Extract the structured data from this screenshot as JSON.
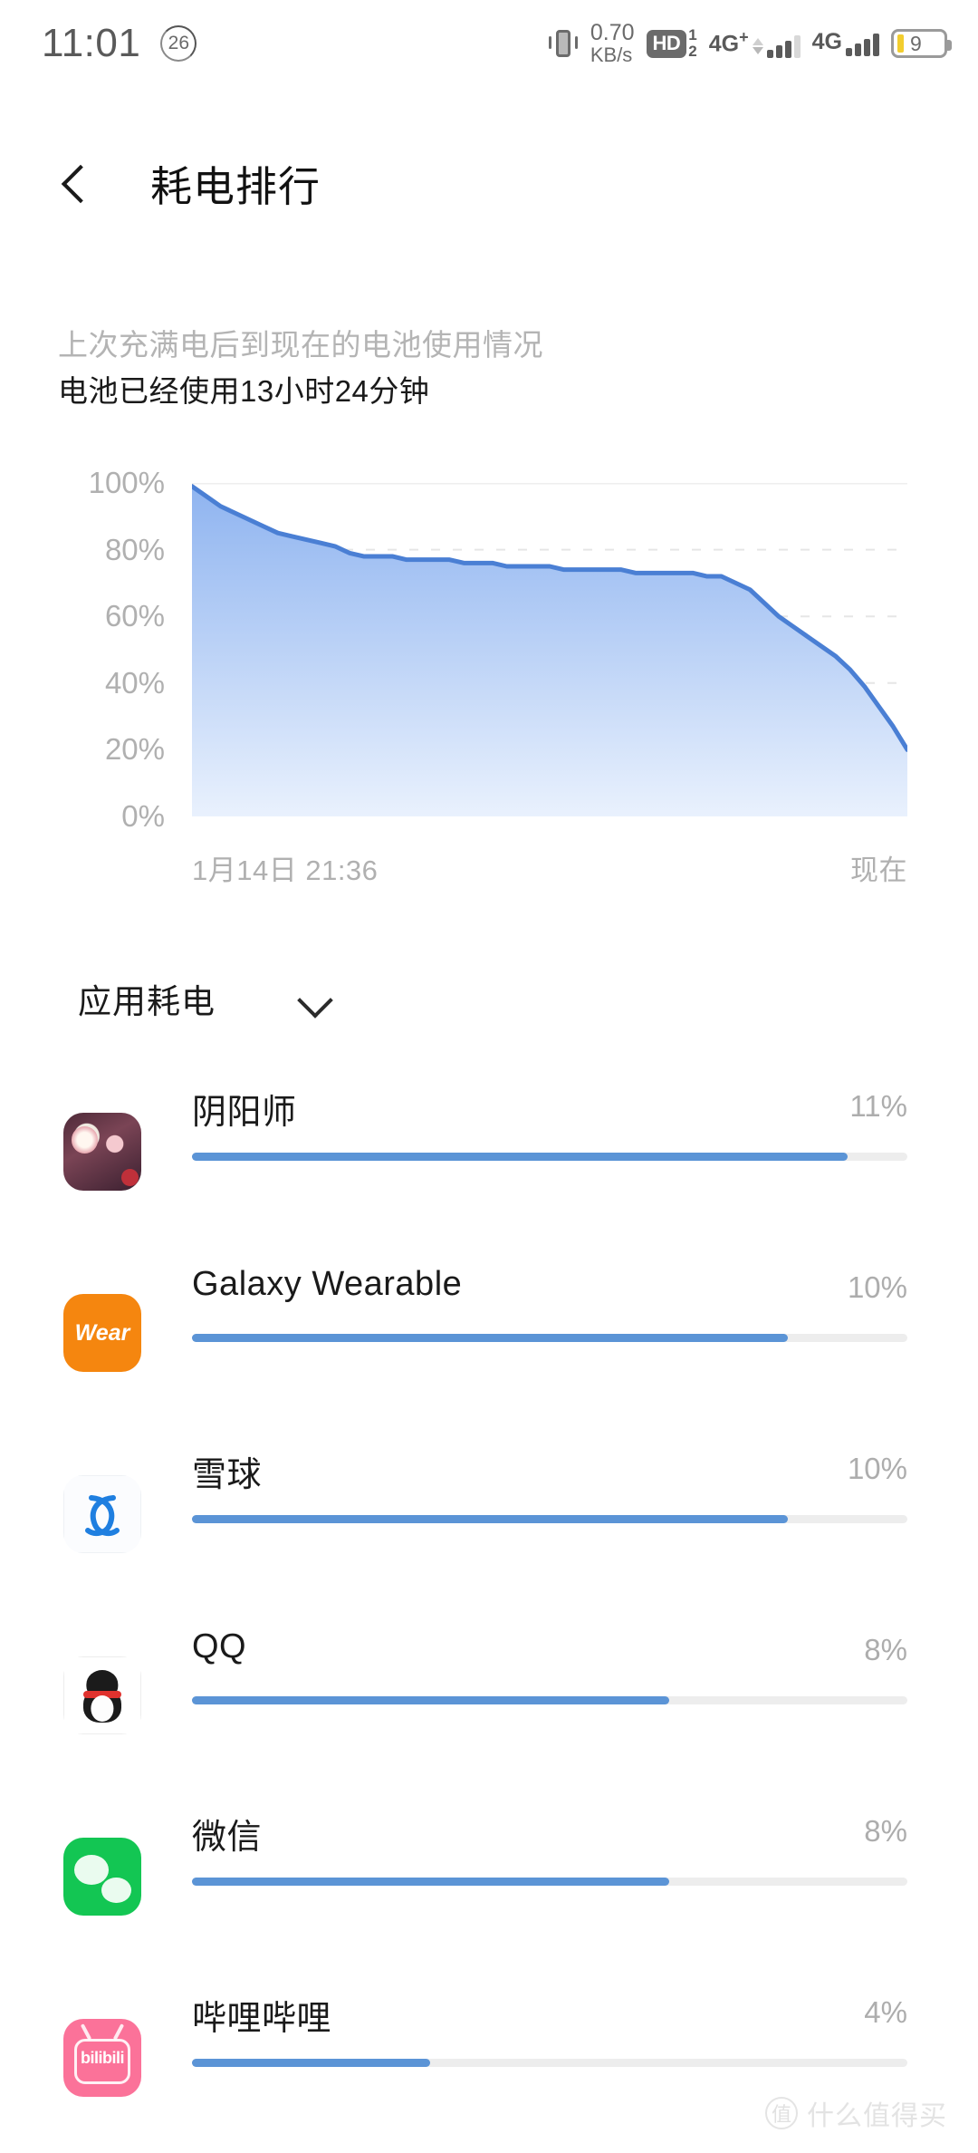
{
  "status_bar": {
    "time": "11:01",
    "badge_count": "26",
    "network_rate": "0.70",
    "network_unit": "KB/s",
    "hd_label": "HD",
    "sim1": "1",
    "sim2": "2",
    "signal_a": "4G",
    "signal_a_plus": "+",
    "signal_b": "4G",
    "battery_level": "9",
    "icons": {
      "vibrate": "vibrate-icon",
      "hd_call": "hd-call-icon",
      "signal": "signal-bars-icon",
      "battery": "battery-icon"
    }
  },
  "app_bar": {
    "back_icon": "back-chevron-icon",
    "title": "耗电排行"
  },
  "summary": {
    "line_gray": "上次充满电后到现在的电池使用情况",
    "line_dark": "电池已经使用13小时24分钟"
  },
  "chart_data": {
    "type": "area",
    "title": "",
    "subtitle": "",
    "xlabel": "",
    "ylabel": "",
    "ylim": [
      0,
      100
    ],
    "grid": true,
    "legend": null,
    "y_ticks": [
      "0%",
      "20%",
      "40%",
      "60%",
      "80%",
      "100%"
    ],
    "y_tick_values": [
      0,
      20,
      40,
      60,
      80,
      100
    ],
    "x_ticks": [
      "1月14日 21:36",
      "现在"
    ],
    "line_color": "#4a7fd4",
    "fill_color_top": "#8fb4f0",
    "fill_color_bottom": "#e8f0fd",
    "x": [
      0,
      2,
      4,
      6,
      8,
      10,
      12,
      14,
      16,
      18,
      20,
      22,
      24,
      26,
      28,
      30,
      32,
      34,
      36,
      38,
      40,
      42,
      44,
      46,
      48,
      50,
      52,
      54,
      56,
      58,
      60,
      62,
      64,
      66,
      68,
      70,
      72,
      74,
      76,
      78,
      80,
      82,
      84,
      86,
      88,
      90,
      92,
      94,
      96,
      98,
      100
    ],
    "values": [
      99,
      96,
      93,
      91,
      89,
      87,
      85,
      84,
      83,
      82,
      81,
      79,
      78,
      78,
      78,
      77,
      77,
      77,
      77,
      76,
      76,
      76,
      75,
      75,
      75,
      75,
      74,
      74,
      74,
      74,
      74,
      73,
      73,
      73,
      73,
      73,
      72,
      72,
      70,
      68,
      64,
      60,
      57,
      54,
      51,
      48,
      44,
      39,
      33,
      27,
      20,
      9
    ]
  },
  "section": {
    "label": "应用耗电",
    "chevron_icon": "chevron-down-icon"
  },
  "apps": [
    {
      "name": "阴阳师",
      "percent": "11%",
      "value": 11,
      "icon": "onmyoji-app-icon"
    },
    {
      "name": "Galaxy Wearable",
      "percent": "10%",
      "value": 10,
      "icon": "galaxy-wearable-app-icon",
      "icon_text": "Wear"
    },
    {
      "name": "雪球",
      "percent": "10%",
      "value": 10,
      "icon": "xueqiu-app-icon"
    },
    {
      "name": "QQ",
      "percent": "8%",
      "value": 8,
      "icon": "qq-app-icon"
    },
    {
      "name": "微信",
      "percent": "8%",
      "value": 8,
      "icon": "wechat-app-icon"
    },
    {
      "name": "哔哩哔哩",
      "percent": "4%",
      "value": 4,
      "icon": "bilibili-app-icon",
      "icon_text": "bilibili"
    }
  ],
  "bar_max_percent": 12,
  "watermark": {
    "mark": "值",
    "text": "什么值得买"
  },
  "colors": {
    "accent_blue": "#5b94d6",
    "chart_line": "#4a7fd4",
    "battery_yellow": "#f2cd2e",
    "track_gray": "#ededed"
  }
}
